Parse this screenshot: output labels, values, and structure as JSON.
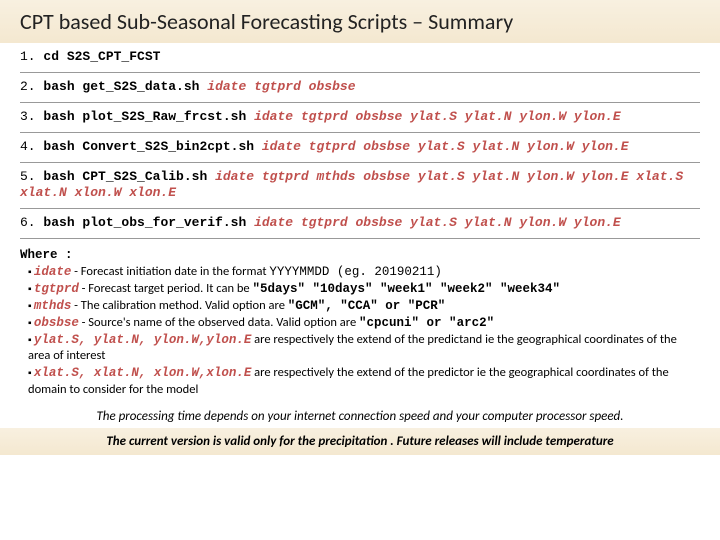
{
  "title": "CPT based Sub-Seasonal Forecasting Scripts – Summary",
  "steps": {
    "s1": {
      "num": "1.",
      "cmd": "cd S2S_CPT_FCST",
      "args": ""
    },
    "s2": {
      "num": "2.",
      "cmd": "bash get_S2S_data.sh",
      "args": "idate tgtprd obsbse"
    },
    "s3": {
      "num": "3.",
      "cmd": "bash plot_S2S_Raw_frcst.sh",
      "args": "idate tgtprd obsbse ylat.S ylat.N ylon.W ylon.E"
    },
    "s4": {
      "num": "4.",
      "cmd": "bash Convert_S2S_bin2cpt.sh",
      "args": "idate tgtprd obsbse ylat.S ylat.N ylon.W ylon.E"
    },
    "s5": {
      "num": "5.",
      "cmd": "bash CPT_S2S_Calib.sh",
      "args": "idate tgtprd mthds obsbse ylat.S ylat.N ylon.W ylon.E xlat.S xlat.N xlon.W xlon.E"
    },
    "s6": {
      "num": "6.",
      "cmd": "bash plot_obs_for_verif.sh",
      "args": "idate tgtprd obsbse ylat.S ylat.N ylon.W ylon.E"
    }
  },
  "where": {
    "title": "Where :",
    "idate_var": "idate",
    "idate_txt": " - Forecast initiation date in the format ",
    "idate_fmt": "YYYYMMDD (eg. 20190211)",
    "tgtprd_var": "tgtprd",
    "tgtprd_txt": " - Forecast target period. It can be ",
    "tgtprd_opts": "\"5days\" \"10days\" \"week1\" \"week2\" \"week34\"",
    "mthds_var": "mthds",
    "mthds_txt": "  - The calibration method. Valid option are ",
    "mthds_opts": "\"GCM\", \"CCA\" or \"PCR\"",
    "obsbse_var": "obsbse",
    "obsbse_txt": " - Source's name of the observed data. Valid option are ",
    "obsbse_opts": "\"cpcuni\"  or \"arc2\"",
    "ylat_var": "ylat.S, ylat.N, ylon.W,ylon.E",
    "ylat_txt": " are respectively the extend of the predictand ie the geographical coordinates of the area of interest",
    "xlat_var": "xlat.S, xlat.N, xlon.W,xlon.E",
    "xlat_txt": " are respectively the extend of the predictor ie the geographical coordinates of the domain to consider for the model"
  },
  "note1": "The processing time depends on your internet connection speed and your computer processor speed.",
  "note2": "The current version is valid only for the precipitation . Future releases will include temperature"
}
